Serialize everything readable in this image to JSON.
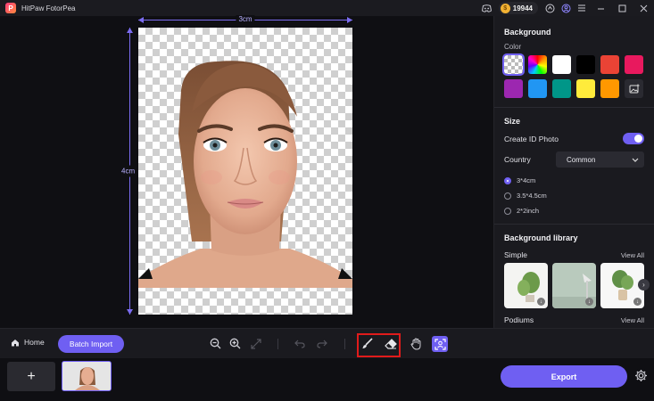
{
  "app": {
    "title": "HitPaw FotorPea",
    "credits": "19944"
  },
  "canvas": {
    "width_label": "3cm",
    "height_label": "4cm"
  },
  "panel": {
    "background_title": "Background",
    "color_label": "Color",
    "swatches": [
      "transparent",
      "rainbow",
      "#ffffff",
      "#000000",
      "#ea4335",
      "#e8195e",
      "#9c27b0",
      "#2196f3",
      "#009688",
      "#ffeb3b",
      "#ff9800",
      "custom"
    ],
    "size_title": "Size",
    "create_id_label": "Create ID Photo",
    "country_label": "Country",
    "country_value": "Common",
    "size_options": [
      "3*4cm",
      "3.5*4.5cm",
      "2*2inch"
    ],
    "selected_size": "3*4cm",
    "library_title": "Background library",
    "simple_label": "Simple",
    "podiums_label": "Podiums",
    "view_all": "View All"
  },
  "toolbar": {
    "home_label": "Home",
    "batch_label": "Batch Import"
  },
  "bottom": {
    "add_label": "+",
    "export_label": "Export"
  },
  "colors": {
    "accent": "#6f5ff2",
    "highlight": "#e01b1b"
  }
}
